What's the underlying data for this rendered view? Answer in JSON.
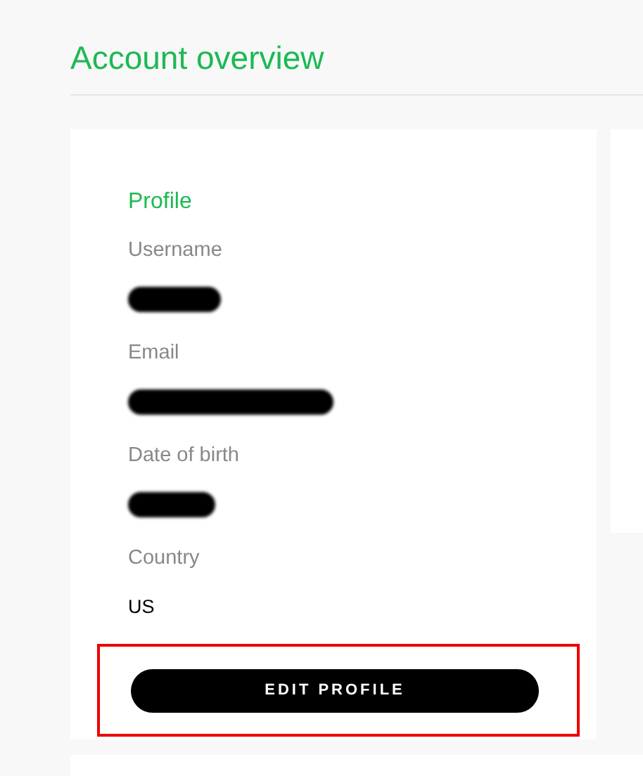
{
  "page": {
    "title": "Account overview"
  },
  "profile": {
    "heading": "Profile",
    "fields": [
      {
        "label": "Username",
        "kind": "redacted"
      },
      {
        "label": "Email",
        "kind": "redacted"
      },
      {
        "label": "Date of birth",
        "kind": "redacted"
      },
      {
        "label": "Country",
        "kind": "text",
        "value": "US"
      }
    ],
    "button": {
      "label": "EDIT PROFILE",
      "highlighted": true
    }
  }
}
